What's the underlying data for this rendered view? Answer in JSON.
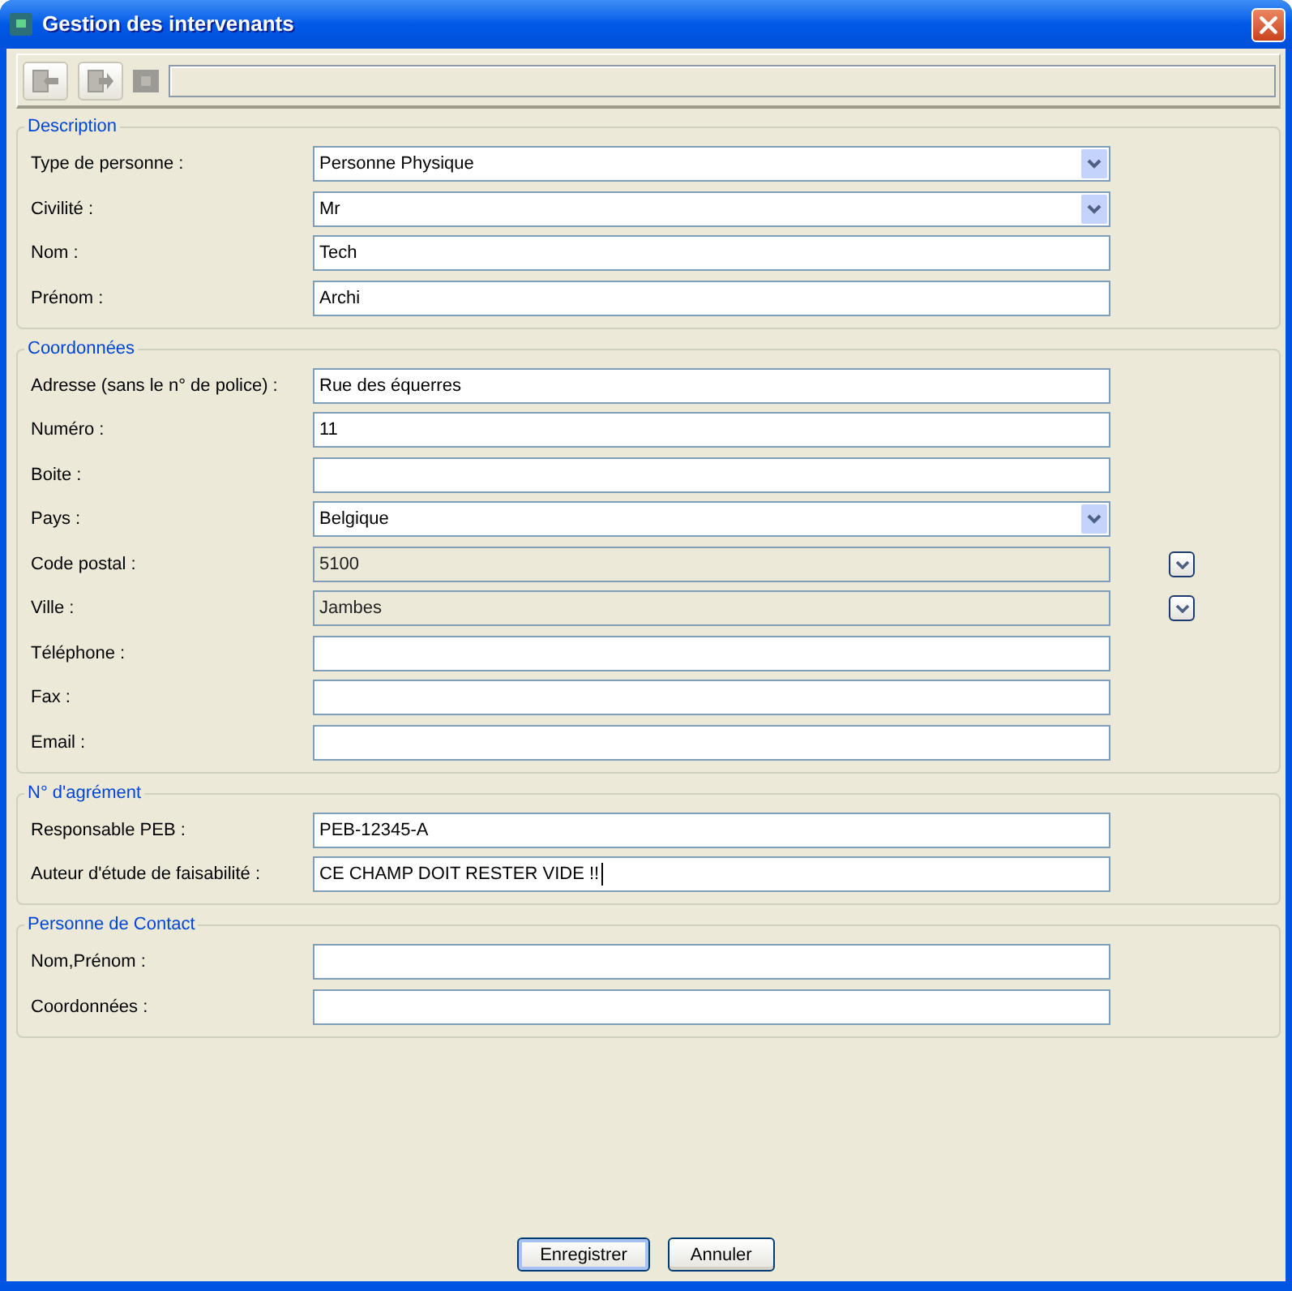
{
  "window": {
    "title": "Gestion des intervenants"
  },
  "toolbar": {
    "buttons": [
      {
        "kind": "page_left",
        "disabled": true
      },
      {
        "kind": "page_right",
        "disabled": true
      },
      {
        "kind": "square",
        "disabled": true
      }
    ]
  },
  "sections": [
    {
      "title": "Description",
      "fields": [
        {
          "label": "Type de personne :",
          "kind": "combo",
          "value": "Personne Physique",
          "disabled": false,
          "focused": false
        },
        {
          "label": "Civilité :",
          "kind": "combo",
          "value": "Mr",
          "disabled": false,
          "focused": false
        },
        {
          "label": "Nom :",
          "kind": "text",
          "value": "Tech",
          "disabled": false,
          "focused": false
        },
        {
          "label": "Prénom :",
          "kind": "text",
          "value": "Archi",
          "disabled": false,
          "focused": false
        }
      ]
    },
    {
      "title": "Coordonnées",
      "fields": [
        {
          "label": "Adresse (sans le n° de police) :",
          "kind": "text",
          "value": "Rue des équerres",
          "disabled": false,
          "focused": false
        },
        {
          "label": "Numéro :",
          "kind": "text",
          "value": "11",
          "disabled": false,
          "focused": false
        },
        {
          "label": "Boite :",
          "kind": "text",
          "disabled": false,
          "focused": false
        },
        {
          "label": "Pays :",
          "kind": "combo",
          "value": "Belgique",
          "disabled": false,
          "focused": false
        },
        {
          "label": "Code postal :",
          "kind": "lookup",
          "value": "5100",
          "disabled": true,
          "focused": false
        },
        {
          "label": "Ville :",
          "kind": "lookup",
          "value": "Jambes",
          "disabled": true,
          "focused": false
        },
        {
          "label": "Téléphone :",
          "kind": "text",
          "disabled": false,
          "focused": false
        },
        {
          "label": "Fax :",
          "kind": "text",
          "disabled": false,
          "focused": false
        },
        {
          "label": "Email :",
          "kind": "text",
          "disabled": false,
          "focused": false
        }
      ]
    },
    {
      "title": "N° d'agrément",
      "fields": [
        {
          "label": "Responsable PEB :",
          "kind": "text",
          "value": "PEB-12345-A",
          "disabled": false,
          "focused": false
        },
        {
          "label": "Auteur d'étude de faisabilité :",
          "kind": "text",
          "value": "CE CHAMP DOIT RESTER VIDE !!",
          "disabled": false,
          "focused": true
        }
      ]
    },
    {
      "title": "Personne de Contact",
      "fields": [
        {
          "label": "Nom,Prénom :",
          "kind": "text",
          "disabled": false,
          "focused": false
        },
        {
          "label": "Coordonnées :",
          "kind": "text",
          "disabled": false,
          "focused": false
        }
      ]
    }
  ],
  "buttons": [
    {
      "label": "Enregistrer",
      "default": true
    },
    {
      "label": "Annuler",
      "default": false
    }
  ]
}
